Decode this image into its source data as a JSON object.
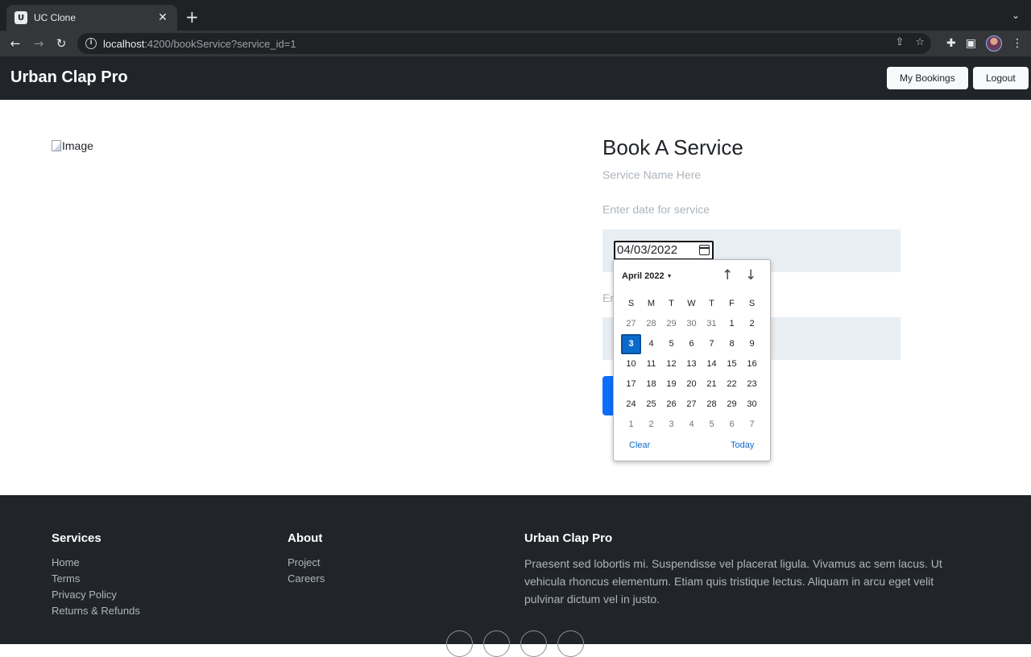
{
  "browser": {
    "tab_title": "UC Clone",
    "url_host": "localhost",
    "url_rest": ":4200/bookService?service_id=1"
  },
  "navbar": {
    "brand": "Urban Clap Pro",
    "my_bookings": "My Bookings",
    "logout": "Logout"
  },
  "main": {
    "image_alt": "Image",
    "title": "Book A Service",
    "service_name": "Service Name Here",
    "date_label": "Enter date for service",
    "date_value": "04/03/2022",
    "time_label_partial": "En"
  },
  "calendar": {
    "month_label": "April 2022",
    "weekdays": [
      "S",
      "M",
      "T",
      "W",
      "T",
      "F",
      "S"
    ],
    "weeks": [
      [
        {
          "d": "27",
          "o": true
        },
        {
          "d": "28",
          "o": true
        },
        {
          "d": "29",
          "o": true
        },
        {
          "d": "30",
          "o": true
        },
        {
          "d": "31",
          "o": true
        },
        {
          "d": "1"
        },
        {
          "d": "2"
        }
      ],
      [
        {
          "d": "3",
          "s": true
        },
        {
          "d": "4"
        },
        {
          "d": "5"
        },
        {
          "d": "6"
        },
        {
          "d": "7"
        },
        {
          "d": "8"
        },
        {
          "d": "9"
        }
      ],
      [
        {
          "d": "10"
        },
        {
          "d": "11"
        },
        {
          "d": "12"
        },
        {
          "d": "13"
        },
        {
          "d": "14"
        },
        {
          "d": "15"
        },
        {
          "d": "16"
        }
      ],
      [
        {
          "d": "17"
        },
        {
          "d": "18"
        },
        {
          "d": "19"
        },
        {
          "d": "20"
        },
        {
          "d": "21"
        },
        {
          "d": "22"
        },
        {
          "d": "23"
        }
      ],
      [
        {
          "d": "24"
        },
        {
          "d": "25"
        },
        {
          "d": "26"
        },
        {
          "d": "27"
        },
        {
          "d": "28"
        },
        {
          "d": "29"
        },
        {
          "d": "30"
        }
      ],
      [
        {
          "d": "1",
          "o": true
        },
        {
          "d": "2",
          "o": true
        },
        {
          "d": "3",
          "o": true
        },
        {
          "d": "4",
          "o": true
        },
        {
          "d": "5",
          "o": true
        },
        {
          "d": "6",
          "o": true
        },
        {
          "d": "7",
          "o": true
        }
      ]
    ],
    "clear": "Clear",
    "today": "Today"
  },
  "footer": {
    "services_heading": "Services",
    "services_links": [
      "Home",
      "Terms",
      "Privacy Policy",
      "Returns & Refunds"
    ],
    "about_heading": "About",
    "about_links": [
      "Project",
      "Careers"
    ],
    "brand_heading": "Urban Clap Pro",
    "brand_text": "Praesent sed lobortis mi. Suspendisse vel placerat ligula. Vivamus ac sem lacus. Ut vehicula rhoncus elementum. Etiam quis tristique lectus. Aliquam in arcu eget velit pulvinar dictum vel in justo."
  },
  "colors": {
    "navbar_bg": "#212529",
    "primary": "#0d6efd",
    "selected_day": "#0b6bcb"
  }
}
